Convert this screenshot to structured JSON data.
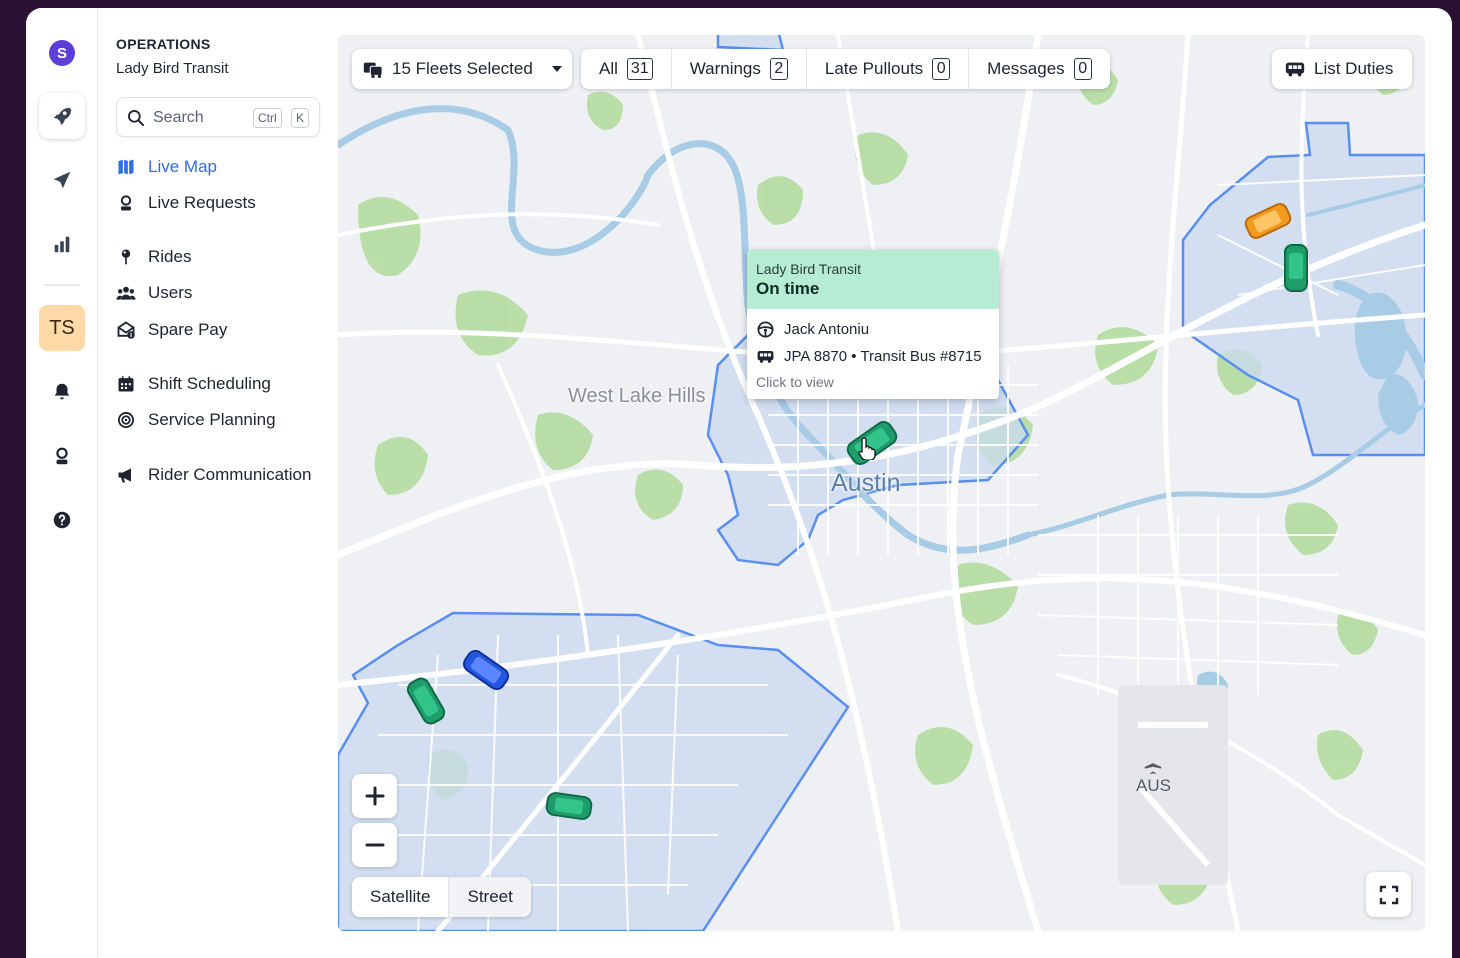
{
  "app": {
    "logo_letter": "S"
  },
  "rail": {
    "items": [
      {
        "icon": "rocket-icon",
        "active": true
      },
      {
        "icon": "paper-plane-icon"
      },
      {
        "icon": "bar-chart-icon"
      },
      {
        "icon": "bell-icon"
      },
      {
        "icon": "agent-icon"
      },
      {
        "icon": "help-icon"
      }
    ],
    "avatar_initials": "TS"
  },
  "sidebar": {
    "eyebrow": "OPERATIONS",
    "org_name": "Lady Bird Transit",
    "search": {
      "placeholder": "Search",
      "shortcut_key1": "Ctrl",
      "shortcut_key2": "K"
    },
    "nav": {
      "live_map": "Live Map",
      "live_requests": "Live Requests",
      "rides": "Rides",
      "users": "Users",
      "spare_pay": "Spare Pay",
      "shift_scheduling": "Shift Scheduling",
      "service_planning": "Service Planning",
      "rider_communication": "Rider Communication"
    },
    "active_item": "Live Map"
  },
  "map": {
    "fleet_selector": "15 Fleets Selected",
    "filters": [
      {
        "label": "All",
        "count": "31"
      },
      {
        "label": "Warnings",
        "count": "2"
      },
      {
        "label": "Late Pullouts",
        "count": "0"
      },
      {
        "label": "Messages",
        "count": "0"
      }
    ],
    "list_duties": "List Duties",
    "labels": {
      "west_lake_hills": "West Lake Hills",
      "austin": "Austin",
      "airport": "AUS"
    },
    "popup": {
      "org": "Lady Bird Transit",
      "status": "On time",
      "driver": "Jack Antoniu",
      "vehicle": "JPA 8870 • Transit Bus #8715",
      "hint": "Click to view"
    },
    "map_type": {
      "satellite": "Satellite",
      "street": "Street",
      "selected": "Street"
    },
    "colors": {
      "zone_fill": "#c9d9f0",
      "zone_stroke": "#5a8ff0",
      "water": "#a8cbe6",
      "park": "#b6dca3",
      "vehicle_green": "#1e9c6a",
      "vehicle_orange": "#f29a1f",
      "vehicle_blue": "#2357e0",
      "accent": "#2f6ee0",
      "popup_header": "#b7ecd4"
    }
  }
}
